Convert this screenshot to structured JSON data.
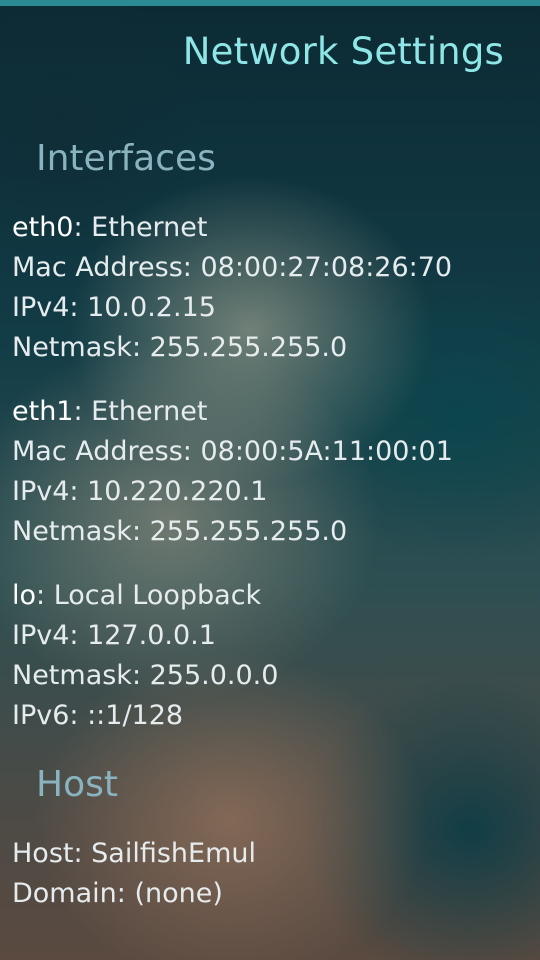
{
  "app": {
    "title": "Network Settings"
  },
  "sections": {
    "interfaces_label": "Interfaces",
    "host_label": "Host"
  },
  "interfaces": [
    {
      "name": "eth0",
      "type": ": Ethernet",
      "mac": "Mac Address: 08:00:27:08:26:70",
      "ipv4": "IPv4: 10.0.2.15",
      "netmask": "Netmask: 255.255.255.0"
    },
    {
      "name": "eth1",
      "type": ": Ethernet",
      "mac": "Mac Address: 08:00:5A:11:00:01",
      "ipv4": "IPv4: 10.220.220.1",
      "netmask": "Netmask: 255.255.255.0"
    },
    {
      "name": "lo",
      "type": ": Local Loopback",
      "ipv4": "IPv4: 127.0.0.1",
      "netmask": "Netmask: 255.0.0.0",
      "ipv6": "IPv6: ::1/128"
    }
  ],
  "host": {
    "host": "Host: SailfishEmul",
    "domain": "Domain: (none)"
  },
  "colors": {
    "accent": "#8fe6e6",
    "section_header": "#8ab3c0",
    "top_bar": "#2a8c92"
  }
}
